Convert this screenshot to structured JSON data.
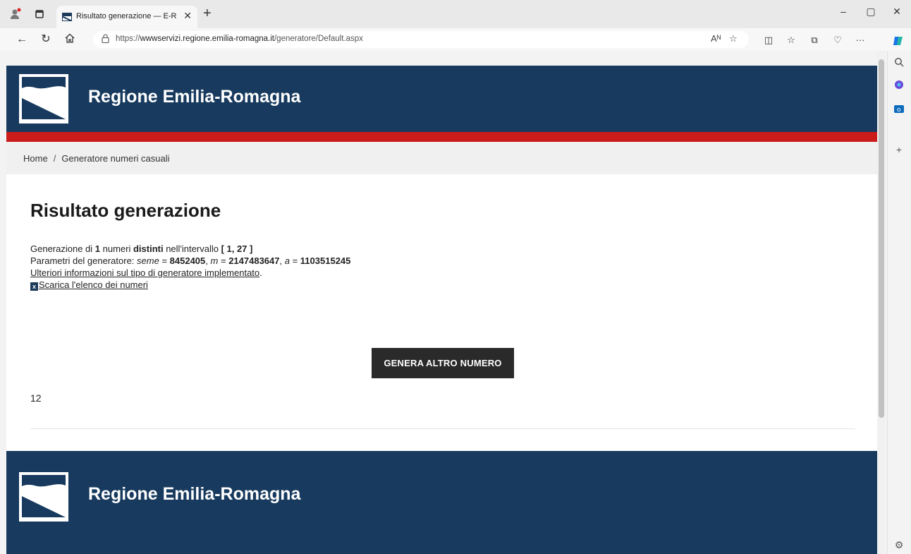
{
  "browser": {
    "tab_title": "Risultato generazione — E-R Il po",
    "url_prefix": "https://",
    "url_host": "wwwservizi.regione.emilia-romagna.it",
    "url_path": "/generatore/Default.aspx",
    "read_aloud_icon": "Aᴺ"
  },
  "header": {
    "brand": "Regione Emilia-Romagna"
  },
  "breadcrumb": {
    "home": "Home",
    "separator": "/",
    "current": "Generatore numeri casuali"
  },
  "main": {
    "title": "Risultato generazione",
    "line1": {
      "prefix": "Generazione di ",
      "count": "1",
      "mid1": " numeri ",
      "kind": "distinti",
      "mid2": " nell'intervallo ",
      "range": "[ 1, 27 ]"
    },
    "line2": {
      "prefix": "Parametri del generatore: ",
      "seed_label": "seme",
      "eq": " = ",
      "seed": "8452405",
      "sep": ", ",
      "m_label": "m",
      "m_value": "2147483647",
      "a_label": "a",
      "a_value": "1103515245"
    },
    "info_link": "Ulteriori informazioni sul tipo di generatore implementato",
    "info_link_suffix": ".",
    "download_link": "Scarica l'elenco dei numeri",
    "button_label": "GENERA ALTRO NUMERO",
    "result": "12"
  },
  "footer": {
    "brand": "Regione Emilia-Romagna"
  }
}
